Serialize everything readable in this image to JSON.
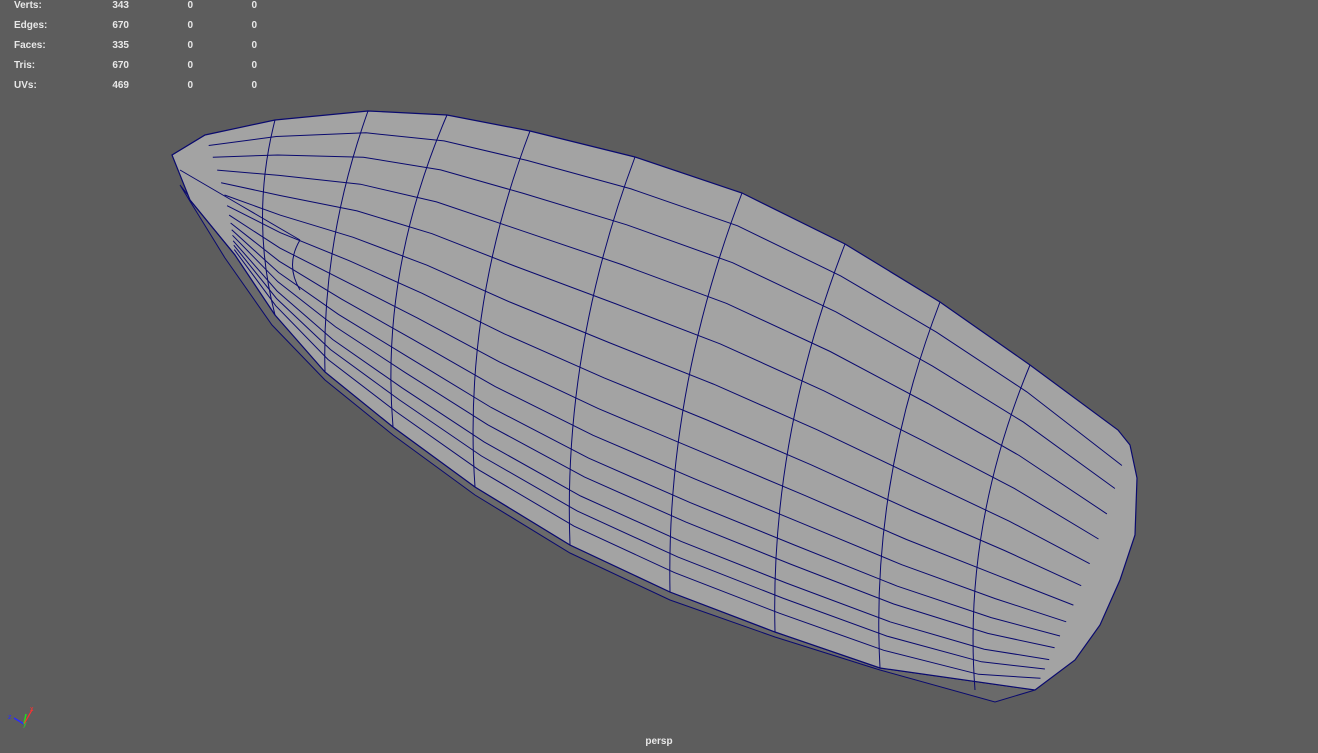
{
  "hud": {
    "rows": [
      {
        "label": "Verts:",
        "value": "343",
        "c2": "0",
        "c3": "0"
      },
      {
        "label": "Edges:",
        "value": "670",
        "c2": "0",
        "c3": "0"
      },
      {
        "label": "Faces:",
        "value": "335",
        "c2": "0",
        "c3": "0"
      },
      {
        "label": "Tris:",
        "value": "670",
        "c2": "0",
        "c3": "0"
      },
      {
        "label": "UVs:",
        "value": "469",
        "c2": "0",
        "c3": "0"
      }
    ]
  },
  "camera_label": "persp",
  "axes": {
    "x": "x",
    "y": "y",
    "z": "z"
  },
  "colors": {
    "background": "#5d5d5d",
    "mesh": "#a3a3a3",
    "wire": "#0a0a6e"
  }
}
